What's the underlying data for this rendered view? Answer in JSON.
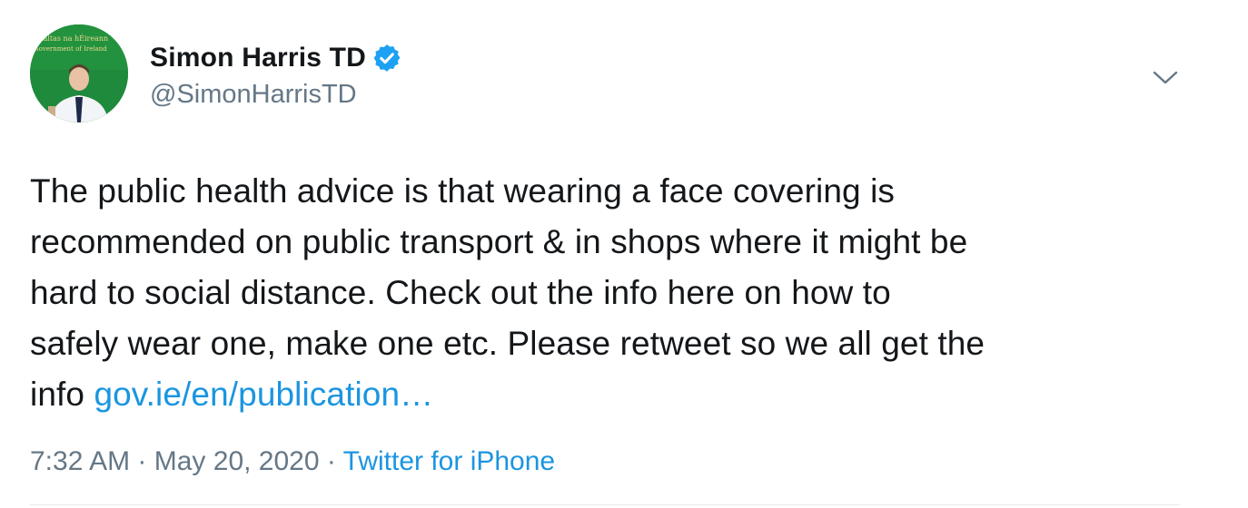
{
  "author": {
    "display_name": "Simon Harris TD",
    "handle": "@SimonHarrisTD",
    "verified": true,
    "avatar_backdrop_text_1": "Rialtas na hÉireann",
    "avatar_backdrop_text_2": "Government of Ireland"
  },
  "tweet": {
    "lines": [
      "The public health advice is that wearing a face covering is",
      "recommended on public transport & in shops where it might be",
      "hard to social distance. Check out the info here on how to",
      "safely wear one, make one etc. Please retweet so we all get the"
    ],
    "last_line_prefix": "info ",
    "link_text": "gov.ie/en/publication…"
  },
  "meta": {
    "time": "7:32 AM",
    "separator": " · ",
    "date": "May 20, 2020",
    "source": "Twitter for iPhone"
  },
  "icons": {
    "verified": "verified-badge-icon",
    "caret": "chevron-down-icon"
  },
  "colors": {
    "link": "#1b95e0",
    "secondary_text": "#657786",
    "verified_badge": "#1da1f2",
    "avatar_background": "#1f8a3c"
  }
}
